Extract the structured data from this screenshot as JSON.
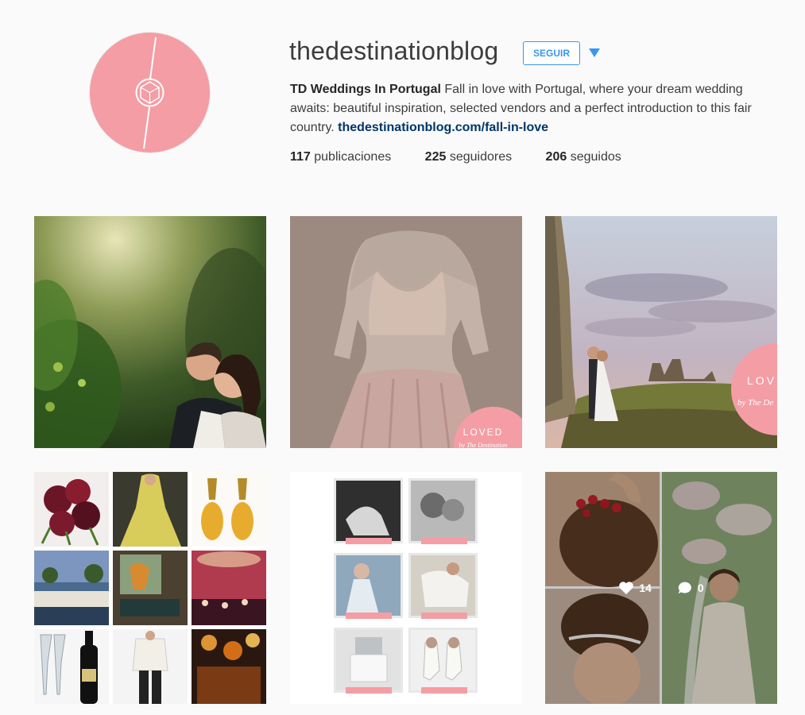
{
  "profile": {
    "username": "thedestinationblog",
    "follow_label": "SEGUIR",
    "bio_name": "TD Weddings In Portugal",
    "bio_text": " Fall in love with Portugal, where your dream wedding awaits: beautiful inspiration, selected vendors and a perfect introduction to this fair country. ",
    "bio_link": "thedestinationblog.com/fall-in-love"
  },
  "stats": {
    "posts_count": "117",
    "posts_label": " publicaciones",
    "followers_count": "225",
    "followers_label": " seguidores",
    "following_count": "206",
    "following_label": " seguidos"
  },
  "posts": [
    {
      "badge_line1": "",
      "badge_line2": ""
    },
    {
      "badge_line1": "LOVED",
      "badge_line2": "by The Destination"
    },
    {
      "badge_line1": "LOV",
      "badge_line2": "by The De"
    },
    {},
    {},
    {
      "likes": "14",
      "comments": "0"
    }
  ],
  "colors": {
    "accent": "#3897f0",
    "avatar_bg": "#f49da4",
    "link": "#003569",
    "badge": "#f49da4"
  }
}
